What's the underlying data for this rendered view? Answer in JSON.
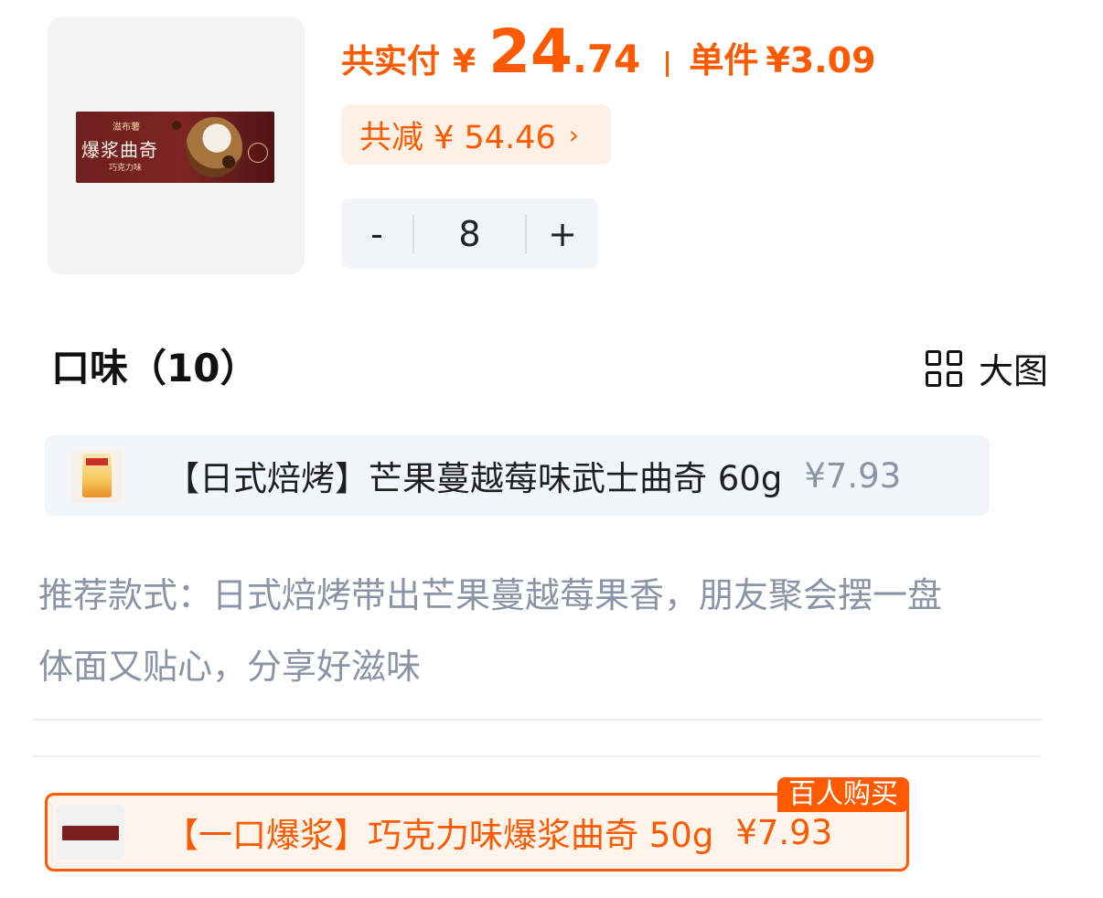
{
  "product": {
    "image_icon": "product-cookie-pack",
    "brand": "滋布薯",
    "pack_name": "爆浆曲奇",
    "pack_flavor": "巧克力味"
  },
  "price": {
    "label": "共实付",
    "currency": "¥",
    "integer": "24",
    "decimal": ".74",
    "unit_label": "单件",
    "unit_price": "¥3.09"
  },
  "discount": {
    "text": "共减 ¥ 54.46",
    "chevron": "›"
  },
  "quantity": {
    "minus": "-",
    "value": "8",
    "plus": "+"
  },
  "section": {
    "title": "口味（10）",
    "view_label": "大图",
    "view_icon": "grid-icon"
  },
  "options": [
    {
      "name": "【日式焙烤】芒果蔓越莓味武士曲奇 60g",
      "price": "¥7.93"
    },
    {
      "name": "【一口爆浆】巧克力味爆浆曲奇 50g",
      "price": "¥7.93",
      "tag": "百人购买",
      "selected": true
    }
  ],
  "description": {
    "line1": "推荐款式：日式焙烤带出芒果蔓越莓果香，朋友聚会摆一盘",
    "line2": "体面又贴心，分享好滋味"
  },
  "colors": {
    "accent": "#ff5a00",
    "muted_text": "#8a94a6",
    "card_bg": "#f2f5f9"
  }
}
